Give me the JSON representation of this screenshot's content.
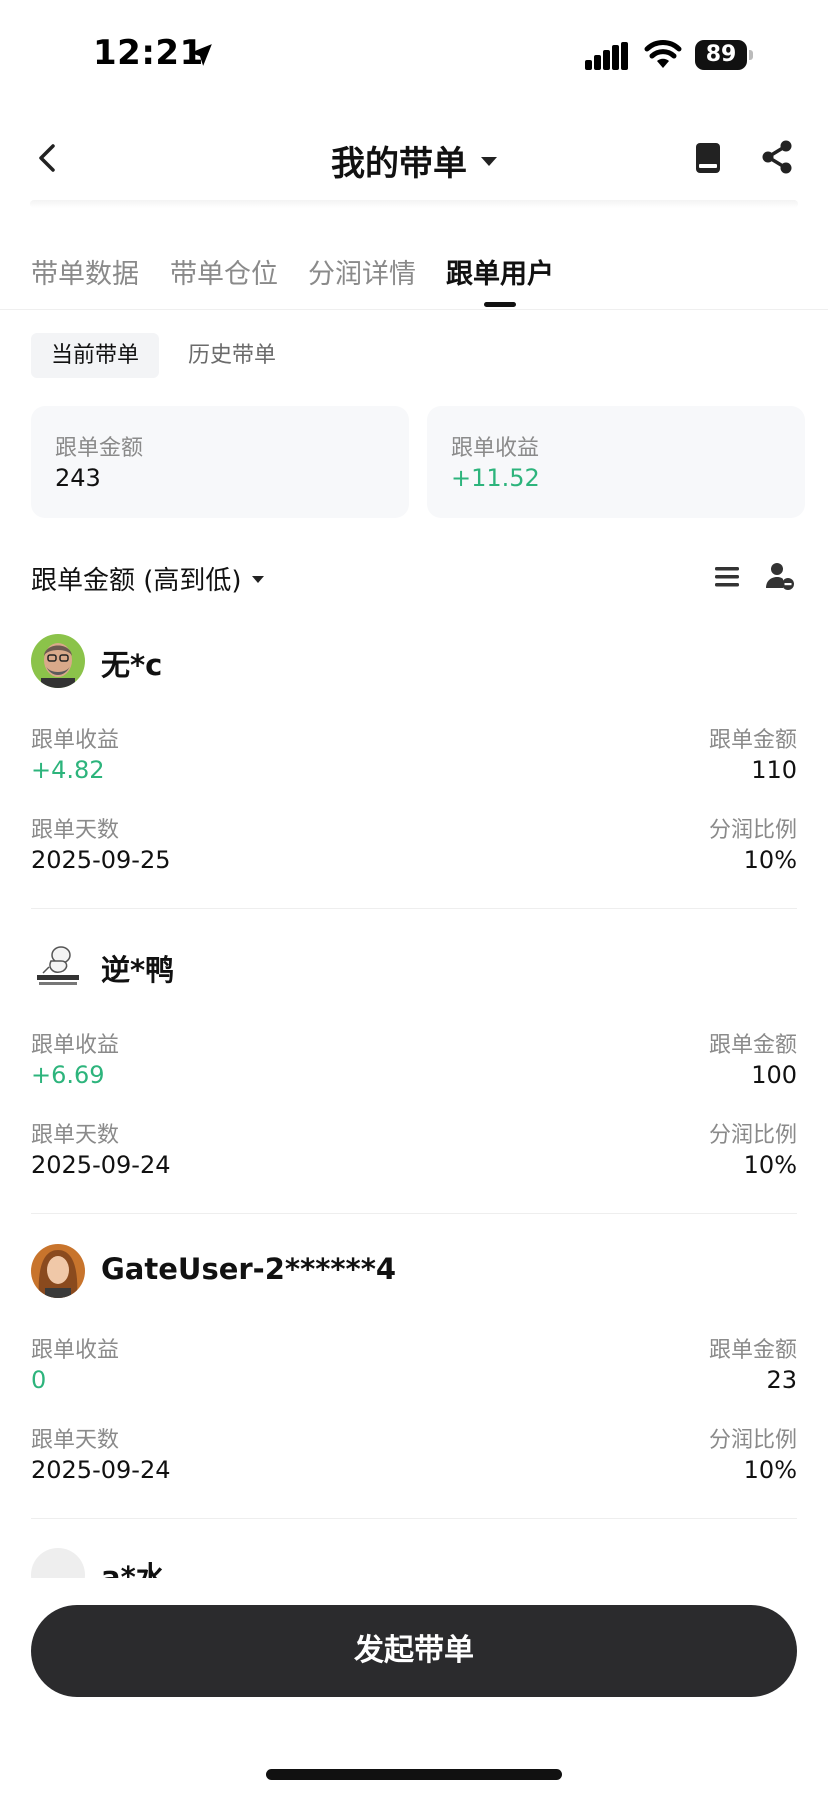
{
  "status_bar": {
    "time": "12:21",
    "battery": "89"
  },
  "header": {
    "title": "我的带单"
  },
  "tabs": [
    {
      "label": "带单数据"
    },
    {
      "label": "带单仓位"
    },
    {
      "label": "分润详情"
    },
    {
      "label": "跟单用户"
    }
  ],
  "subtabs": {
    "current": "当前带单",
    "history": "历史带单"
  },
  "summary": {
    "amount_label": "跟单金额",
    "amount_value": "243",
    "profit_label": "跟单收益",
    "profit_value": "+11.52"
  },
  "sort": {
    "label": "跟单金额 (高到低)"
  },
  "users": [
    {
      "name": "无*c",
      "profit_label": "跟单收益",
      "profit": "+4.82",
      "amount_label": "跟单金额",
      "amount": "110",
      "days_label": "跟单天数",
      "days": "2025-09-25",
      "share_label": "分润比例",
      "share": "10%"
    },
    {
      "name": "逆*鸭",
      "profit_label": "跟单收益",
      "profit": "+6.69",
      "amount_label": "跟单金额",
      "amount": "100",
      "days_label": "跟单天数",
      "days": "2025-09-24",
      "share_label": "分润比例",
      "share": "10%"
    },
    {
      "name": "GateUser-2******4",
      "profit_label": "跟单收益",
      "profit": "0",
      "amount_label": "跟单金额",
      "amount": "23",
      "days_label": "跟单天数",
      "days": "2025-09-24",
      "share_label": "分润比例",
      "share": "10%"
    }
  ],
  "partial_user": {
    "name": "a*水"
  },
  "bottom": {
    "button_label": "发起带单"
  },
  "colors": {
    "profit_green": "#2db47c",
    "button_dark": "#2b2b2d"
  }
}
